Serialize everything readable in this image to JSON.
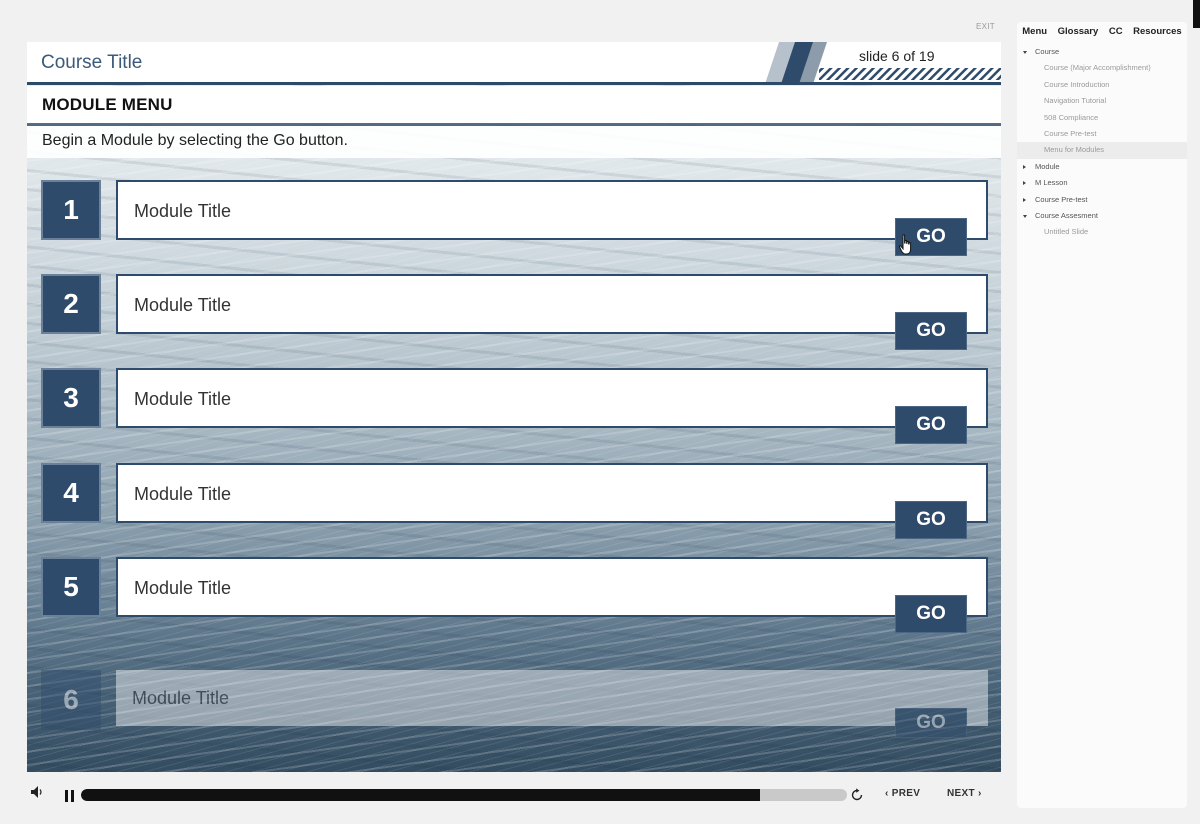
{
  "top_bar": {
    "exit_label": "EXIT"
  },
  "slide": {
    "course_title": "Course Title",
    "slide_counter": "slide 6 of 19",
    "menu_title": "MODULE MENU",
    "instructions": "Begin a Module by selecting the Go button.",
    "modules": [
      {
        "number": "1",
        "title": "Module Title",
        "go_label": "GO"
      },
      {
        "number": "2",
        "title": "Module Title",
        "go_label": "GO"
      },
      {
        "number": "3",
        "title": "Module Title",
        "go_label": "GO"
      },
      {
        "number": "4",
        "title": "Module Title",
        "go_label": "GO"
      },
      {
        "number": "5",
        "title": "Module Title",
        "go_label": "GO"
      },
      {
        "number": "6",
        "title": "Module Title",
        "go_label": "GO"
      }
    ]
  },
  "player": {
    "progress_fraction": 0.886,
    "prev_label": "PREV",
    "next_label": "NEXT"
  },
  "sidebar": {
    "tabs": [
      "Menu",
      "Glossary",
      "CC",
      "Resources"
    ],
    "tree": [
      {
        "label": "Course",
        "level": "top",
        "state": "expanded"
      },
      {
        "label": "Course (Major Accomplishment)",
        "level": "child"
      },
      {
        "label": "Course Introduction",
        "level": "child"
      },
      {
        "label": "Navigation Tutorial",
        "level": "child"
      },
      {
        "label": "508 Compliance",
        "level": "child"
      },
      {
        "label": "Course Pre-test",
        "level": "child"
      },
      {
        "label": "Menu for Modules",
        "level": "child",
        "active": true
      },
      {
        "label": "Module",
        "level": "top",
        "state": "collapsed"
      },
      {
        "label": "M Lesson",
        "level": "top",
        "state": "collapsed"
      },
      {
        "label": "Course Pre-test",
        "level": "top",
        "state": "collapsed"
      },
      {
        "label": "Course Assesment",
        "level": "top",
        "state": "expanded"
      },
      {
        "label": "Untitled Slide",
        "level": "child"
      }
    ]
  },
  "colors": {
    "navy": "#2f4b6b",
    "header_text": "#3c5a7a"
  }
}
